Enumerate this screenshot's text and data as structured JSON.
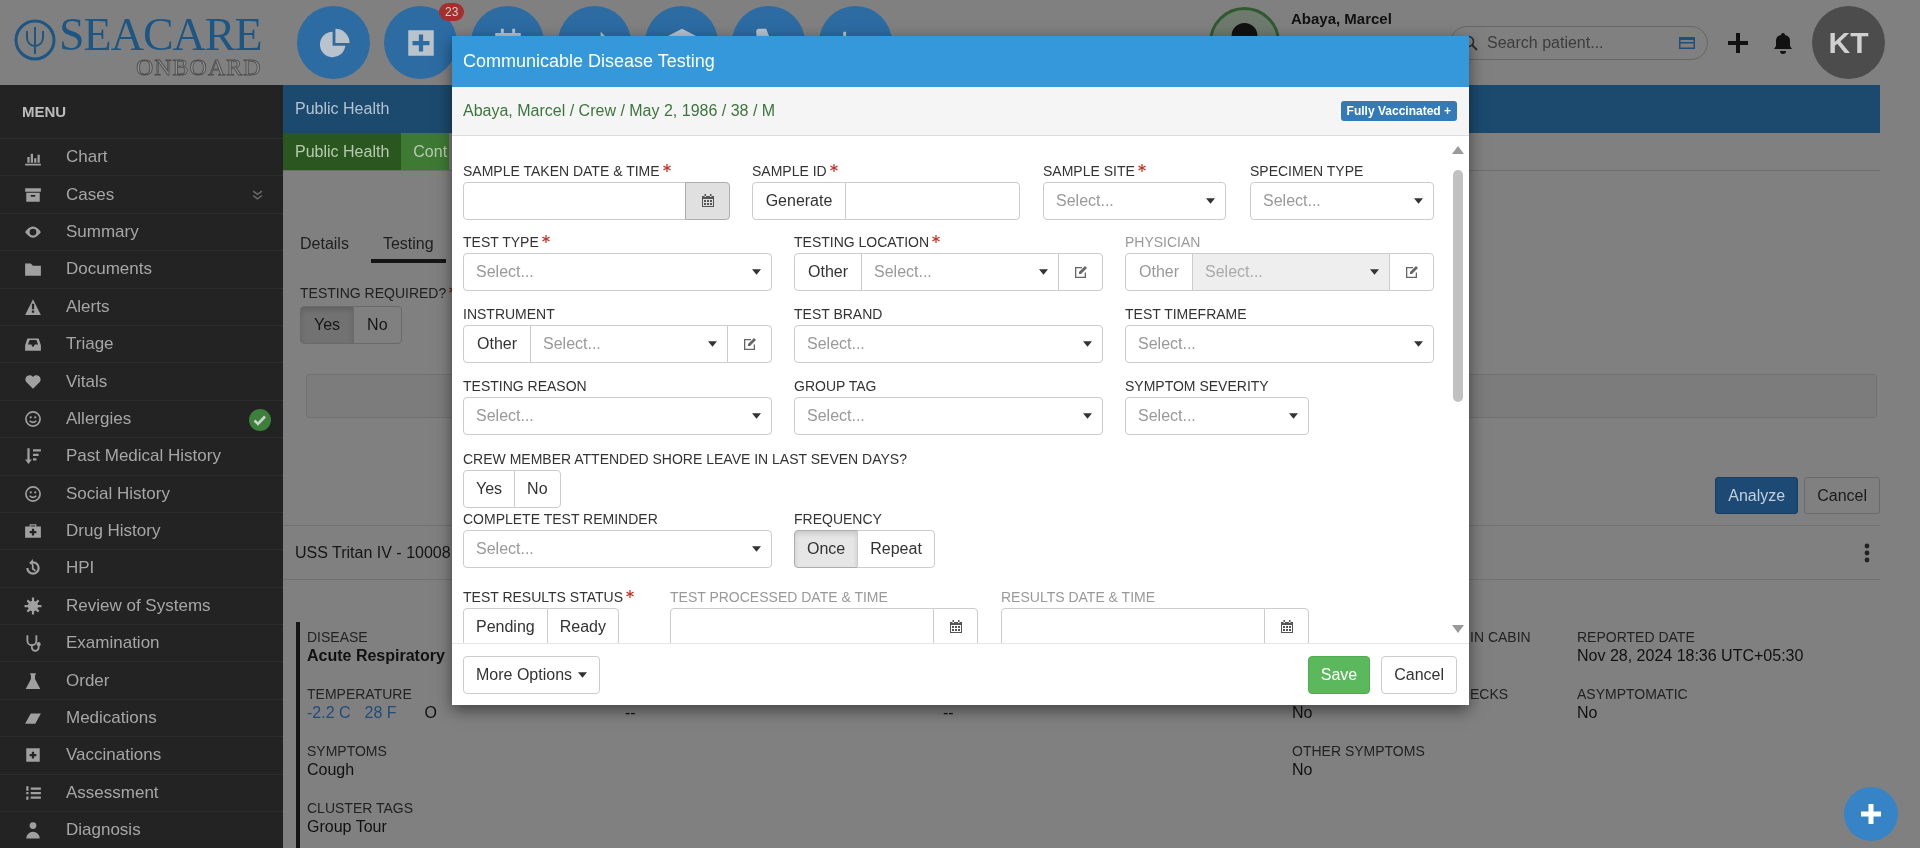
{
  "top_bar": {
    "logo": {
      "name": "SEACARE",
      "tagline": "ONBOARD"
    },
    "notification_badge": "23",
    "patient": {
      "name": "Abaya, Marcel"
    },
    "search": {
      "placeholder": "Search patient..."
    },
    "user_initials": "KT"
  },
  "sidebar": {
    "title": "MENU",
    "items": [
      {
        "label": "Chart",
        "expandable": false,
        "done": false
      },
      {
        "label": "Cases",
        "expandable": true,
        "done": false
      },
      {
        "label": "Summary",
        "expandable": false,
        "done": false
      },
      {
        "label": "Documents",
        "expandable": false,
        "done": false
      },
      {
        "label": "Alerts",
        "expandable": false,
        "done": false
      },
      {
        "label": "Triage",
        "expandable": false,
        "done": false
      },
      {
        "label": "Vitals",
        "expandable": false,
        "done": false
      },
      {
        "label": "Allergies",
        "expandable": false,
        "done": true
      },
      {
        "label": "Past Medical History",
        "expandable": false,
        "done": false
      },
      {
        "label": "Social History",
        "expandable": false,
        "done": false
      },
      {
        "label": "Drug History",
        "expandable": false,
        "done": false
      },
      {
        "label": "HPI",
        "expandable": false,
        "done": false
      },
      {
        "label": "Review of Systems",
        "expandable": false,
        "done": false
      },
      {
        "label": "Examination",
        "expandable": false,
        "done": false
      },
      {
        "label": "Order",
        "expandable": false,
        "done": false
      },
      {
        "label": "Medications",
        "expandable": false,
        "done": false
      },
      {
        "label": "Vaccinations",
        "expandable": false,
        "done": false
      },
      {
        "label": "Assessment",
        "expandable": false,
        "done": false
      },
      {
        "label": "Diagnosis",
        "expandable": false,
        "done": false
      }
    ]
  },
  "page": {
    "section_title": "Public Health",
    "tabs": [
      {
        "label": "Public Health",
        "selected": true
      },
      {
        "label": "Cont",
        "selected": false
      }
    ],
    "subtabs": [
      {
        "label": "Details",
        "selected": false
      },
      {
        "label": "Testing",
        "selected": true
      }
    ],
    "testing_required": {
      "label": "TESTING REQUIRED?",
      "required": true,
      "options": [
        {
          "label": "Yes",
          "selected": true
        },
        {
          "label": "No",
          "selected": false
        }
      ]
    },
    "actions": [
      {
        "label": "Analyze",
        "kind": "primary"
      },
      {
        "label": "Cancel",
        "kind": "default"
      }
    ],
    "case_title": "USS Tritan IV - 10008",
    "details": [
      {
        "column_1": {
          "label": "DISEASE",
          "value": "Acute Respiratory"
        },
        "column_4": {
          "label": "IN CABIN"
        },
        "column_5": {
          "label": "REPORTED DATE",
          "value": "Nov 28, 2024 18:36 UTC+05:30"
        }
      },
      {
        "column_1": {
          "label": "TEMPERATURE",
          "values": [
            {
              "text": "-2.2 C",
              "link": true
            },
            {
              "text": "28 F",
              "link": true
            },
            {
              "text": "O",
              "link": false
            }
          ]
        },
        "column_2": {
          "value": "--"
        },
        "column_3": {
          "value": "--"
        },
        "column_4": {
          "label": "ECKS",
          "value": "No"
        },
        "column_5": {
          "label": "ASYMPTOMATIC",
          "value": "No"
        }
      },
      {
        "column_1": {
          "label": "SYMPTOMS",
          "value": "Cough"
        },
        "column_4": {
          "label": "OTHER SYMPTOMS",
          "value": "No"
        }
      },
      {
        "column_1": {
          "label": "CLUSTER TAGS",
          "value": "Group Tour"
        }
      }
    ]
  },
  "modal": {
    "title": "Communicable Disease Testing",
    "patient_line": "Abaya, Marcel / Crew / May 2, 1986 / 38 / M",
    "badge": "Fully Vaccinated +",
    "form_rows": [
      [
        {
          "kind": "date",
          "label": "SAMPLE TAKEN DATE & TIME",
          "required": true,
          "disabled": false
        },
        {
          "kind": "generate",
          "label": "SAMPLE ID",
          "required": true,
          "disabled": false,
          "button": "Generate"
        },
        {
          "kind": "select",
          "label": "SAMPLE SITE",
          "required": true,
          "disabled": false,
          "placeholder": "Select..."
        },
        {
          "kind": "select",
          "label": "SPECIMEN TYPE",
          "required": false,
          "disabled": false,
          "placeholder": "Select..."
        }
      ],
      [
        {
          "kind": "select",
          "label": "TEST TYPE",
          "required": true,
          "disabled": false,
          "placeholder": "Select..."
        },
        {
          "kind": "other_select",
          "label": "TESTING LOCATION",
          "required": true,
          "disabled": false,
          "button": "Other",
          "placeholder": "Select..."
        },
        {
          "kind": "other_select",
          "label": "PHYSICIAN",
          "required": false,
          "disabled": true,
          "button": "Other",
          "placeholder": "Select..."
        }
      ],
      [
        {
          "kind": "other_select",
          "label": "INSTRUMENT",
          "required": false,
          "disabled": false,
          "button": "Other",
          "placeholder": "Select..."
        },
        {
          "kind": "select",
          "label": "TEST BRAND",
          "required": false,
          "disabled": false,
          "placeholder": "Select..."
        },
        {
          "kind": "select",
          "label": "TEST TIMEFRAME",
          "required": false,
          "disabled": false,
          "placeholder": "Select..."
        }
      ],
      [
        {
          "kind": "select",
          "label": "TESTING REASON",
          "required": false,
          "disabled": false,
          "placeholder": "Select..."
        },
        {
          "kind": "select",
          "label": "GROUP TAG",
          "required": false,
          "disabled": false,
          "placeholder": "Select..."
        },
        {
          "kind": "select",
          "label": "SYMPTOM SEVERITY",
          "required": false,
          "disabled": false,
          "placeholder": "Select..."
        }
      ],
      [
        {
          "kind": "toggle",
          "label": "CREW MEMBER ATTENDED SHORE LEAVE IN LAST SEVEN DAYS?",
          "required": false,
          "disabled": false,
          "options": [
            {
              "label": "Yes",
              "selected": false
            },
            {
              "label": "No",
              "selected": false
            }
          ]
        }
      ],
      [
        {
          "kind": "select",
          "label": "COMPLETE TEST REMINDER",
          "required": false,
          "disabled": false,
          "placeholder": "Select..."
        },
        {
          "kind": "toggle",
          "label": "FREQUENCY",
          "required": false,
          "disabled": false,
          "options": [
            {
              "label": "Once",
              "selected": true
            },
            {
              "label": "Repeat",
              "selected": false
            }
          ]
        }
      ],
      [
        {
          "kind": "toggle",
          "label": "TEST RESULTS STATUS",
          "required": true,
          "disabled": false,
          "options": [
            {
              "label": "Pending",
              "selected": false
            },
            {
              "label": "Ready",
              "selected": false
            }
          ]
        },
        {
          "kind": "date",
          "label": "TEST PROCESSED DATE & TIME",
          "required": false,
          "disabled": true
        },
        {
          "kind": "date",
          "label": "RESULTS DATE & TIME",
          "required": false,
          "disabled": true
        }
      ]
    ],
    "footer": {
      "more_options": "More Options",
      "save": "Save",
      "cancel": "Cancel"
    }
  }
}
